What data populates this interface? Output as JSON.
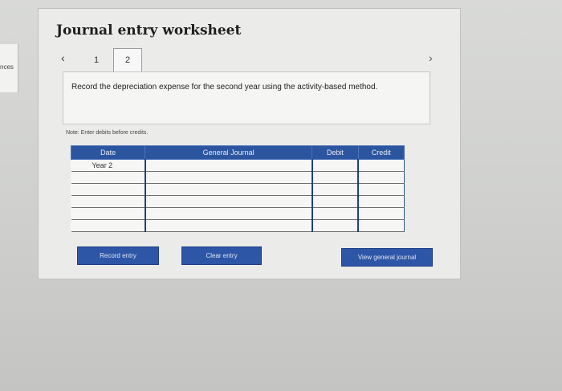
{
  "sidebar": {
    "fragment_label": "nces"
  },
  "worksheet": {
    "title": "Journal entry worksheet",
    "nav": {
      "prev_icon": "‹",
      "next_icon": "›"
    },
    "tabs": [
      {
        "label": "1"
      },
      {
        "label": "2"
      }
    ],
    "active_tab": "2",
    "instruction": "Record the depreciation expense for the second year using the activity-based method.",
    "note": "Note: Enter debits before credits.",
    "table": {
      "columns": [
        "Date",
        "General Journal",
        "Debit",
        "Credit"
      ],
      "rows": [
        {
          "date": "Year 2",
          "account": "",
          "debit": "",
          "credit": ""
        },
        {
          "date": "",
          "account": "",
          "debit": "",
          "credit": ""
        },
        {
          "date": "",
          "account": "",
          "debit": "",
          "credit": ""
        },
        {
          "date": "",
          "account": "",
          "debit": "",
          "credit": ""
        },
        {
          "date": "",
          "account": "",
          "debit": "",
          "credit": ""
        },
        {
          "date": "",
          "account": "",
          "debit": "",
          "credit": ""
        }
      ]
    },
    "buttons": {
      "record": "Record entry",
      "clear": "Clear entry",
      "view": "View general journal"
    }
  },
  "colors": {
    "header_blue": "#2c55a0",
    "button_blue": "#2e56a6"
  }
}
